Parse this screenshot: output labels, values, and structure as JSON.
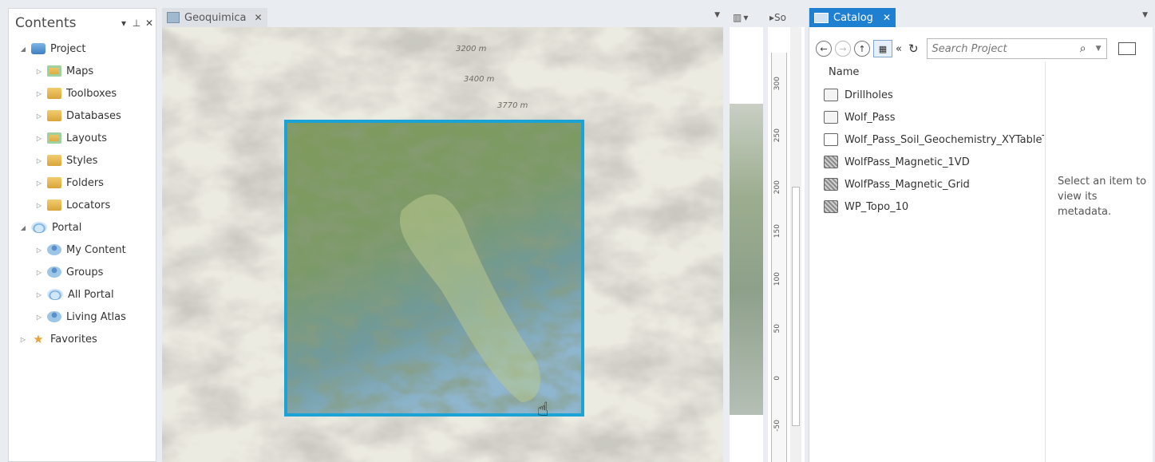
{
  "contents": {
    "title": "Contents",
    "controls": {
      "menu": "▾",
      "pin": "⊥",
      "close": "✕"
    },
    "tree": [
      {
        "label": "Project",
        "level": 0,
        "expanded": true,
        "icon": "project-icon"
      },
      {
        "label": "Maps",
        "level": 1,
        "icon": "maps-folder-icon"
      },
      {
        "label": "Toolboxes",
        "level": 1,
        "icon": "toolboxes-folder-icon"
      },
      {
        "label": "Databases",
        "level": 1,
        "icon": "databases-folder-icon"
      },
      {
        "label": "Layouts",
        "level": 1,
        "icon": "layouts-folder-icon"
      },
      {
        "label": "Styles",
        "level": 1,
        "icon": "styles-folder-icon"
      },
      {
        "label": "Folders",
        "level": 1,
        "icon": "folders-folder-icon"
      },
      {
        "label": "Locators",
        "level": 1,
        "icon": "locators-folder-icon"
      },
      {
        "label": "Portal",
        "level": 0,
        "expanded": true,
        "icon": "portal-cloud-icon"
      },
      {
        "label": "My Content",
        "level": 1,
        "icon": "my-content-icon"
      },
      {
        "label": "Groups",
        "level": 1,
        "icon": "groups-icon"
      },
      {
        "label": "All Portal",
        "level": 1,
        "icon": "all-portal-icon"
      },
      {
        "label": "Living Atlas",
        "level": 1,
        "icon": "living-atlas-icon"
      },
      {
        "label": "Favorites",
        "level": 0,
        "expanded": false,
        "icon": "favorites-star-icon"
      }
    ]
  },
  "map_view": {
    "tab_label": "Geoquimica",
    "close": "✕",
    "elevation_labels": [
      "3200 m",
      "3400 m",
      "3770 m"
    ]
  },
  "layout_view": {
    "tab_fragment": "So",
    "ruler_labels": [
      "300",
      "250",
      "200",
      "150",
      "100",
      "50",
      "0",
      "-50"
    ]
  },
  "catalog": {
    "tab_label": "Catalog",
    "close": "✕",
    "search_placeholder": "Search Project",
    "column_header": "Name",
    "items": [
      {
        "name": "Drillholes",
        "icon": "feature-layer-icon"
      },
      {
        "name": "Wolf_Pass",
        "icon": "feature-layer-icon"
      },
      {
        "name": "Wolf_Pass_Soil_Geochemistry_XYTableToPoint",
        "icon": "table-icon"
      },
      {
        "name": "WolfPass_Magnetic_1VD",
        "icon": "raster-icon"
      },
      {
        "name": "WolfPass_Magnetic_Grid",
        "icon": "raster-icon"
      },
      {
        "name": "WP_Topo_10",
        "icon": "raster-icon"
      }
    ],
    "metadata_hint": "Select an item to view its metadata."
  },
  "colors": {
    "accent": "#1f7fd1",
    "selection_frame": "#1aa3d4"
  }
}
